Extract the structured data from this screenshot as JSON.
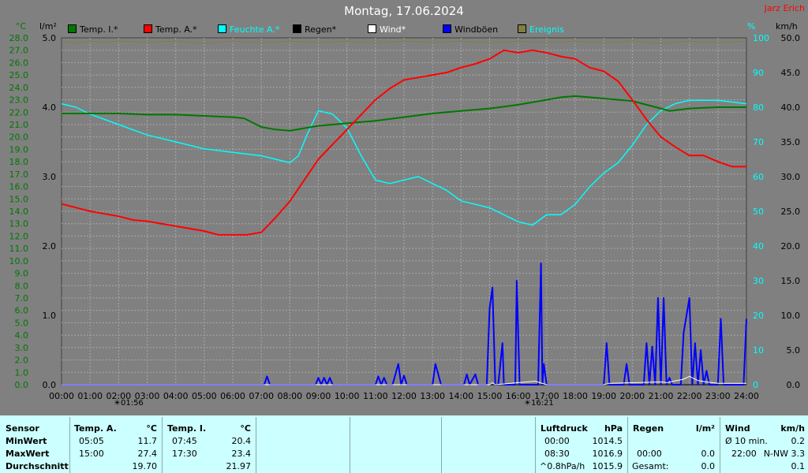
{
  "header": {
    "title": "Montag, 17.06.2024",
    "author": "Jarz Erich",
    "unit_temp": "°C",
    "unit_rain": "l/m²",
    "unit_hum": "%",
    "unit_wind": "km/h"
  },
  "legend": [
    {
      "label": "Temp. I.*",
      "color": "#007700"
    },
    {
      "label": "Temp. A.*",
      "color": "#ff0000"
    },
    {
      "label": "Feuchte A.*",
      "color": "#00ffff"
    },
    {
      "label": "Regen*",
      "color": "#000000"
    },
    {
      "label": "Wind*",
      "color": "#ffffff"
    },
    {
      "label": "Windböen",
      "color": "#0000ff"
    },
    {
      "label": "Ereignis",
      "color": "#808040"
    }
  ],
  "sun": {
    "sunrise": "01:56",
    "sunset": "16:21"
  },
  "chart_data": {
    "type": "line",
    "x_unit": "hours",
    "xlim": [
      0,
      24
    ],
    "x_ticks": [
      "00:00",
      "01:00",
      "02:00",
      "03:00",
      "04:00",
      "05:00",
      "06:00",
      "07:00",
      "08:00",
      "09:00",
      "10:00",
      "11:00",
      "12:00",
      "13:00",
      "14:00",
      "15:00",
      "16:00",
      "17:00",
      "18:00",
      "19:00",
      "20:00",
      "21:00",
      "22:00",
      "23:00",
      "24:00"
    ],
    "axes": {
      "temp": {
        "label": "°C",
        "min": 0,
        "max": 28,
        "step": 1
      },
      "rain": {
        "label": "l/m²",
        "min": 0,
        "max": 5,
        "ticks": [
          "0.0",
          "1.0",
          "2.0",
          "3.0",
          "4.0",
          "5.0"
        ]
      },
      "humidity": {
        "label": "%",
        "min": 0,
        "max": 100,
        "step": 10
      },
      "wind": {
        "label": "km/h",
        "min": 0,
        "max": 50,
        "step": 5
      }
    },
    "series": [
      {
        "name": "Temp. I.*",
        "axis": "temp",
        "color": "#007700",
        "points": [
          [
            0,
            21.9
          ],
          [
            1,
            21.9
          ],
          [
            2,
            21.9
          ],
          [
            3,
            21.8
          ],
          [
            4,
            21.8
          ],
          [
            5,
            21.7
          ],
          [
            6,
            21.6
          ],
          [
            6.4,
            21.5
          ],
          [
            7,
            20.8
          ],
          [
            7.5,
            20.6
          ],
          [
            8,
            20.5
          ],
          [
            8.5,
            20.7
          ],
          [
            9,
            20.9
          ],
          [
            10,
            21.1
          ],
          [
            11,
            21.3
          ],
          [
            12,
            21.6
          ],
          [
            13,
            21.9
          ],
          [
            14,
            22.1
          ],
          [
            15,
            22.3
          ],
          [
            16,
            22.6
          ],
          [
            17,
            23.0
          ],
          [
            17.5,
            23.2
          ],
          [
            18,
            23.3
          ],
          [
            18.5,
            23.2
          ],
          [
            19,
            23.1
          ],
          [
            20,
            22.9
          ],
          [
            20.5,
            22.6
          ],
          [
            21,
            22.3
          ],
          [
            21.3,
            22.1
          ],
          [
            22,
            22.3
          ],
          [
            23,
            22.4
          ],
          [
            24,
            22.4
          ]
        ]
      },
      {
        "name": "Temp. A.*",
        "axis": "temp",
        "color": "#ff0000",
        "points": [
          [
            0,
            14.6
          ],
          [
            0.5,
            14.3
          ],
          [
            1,
            14.0
          ],
          [
            2,
            13.6
          ],
          [
            2.5,
            13.3
          ],
          [
            3,
            13.2
          ],
          [
            4,
            12.8
          ],
          [
            5,
            12.4
          ],
          [
            5.5,
            12.1
          ],
          [
            6,
            12.1
          ],
          [
            6.5,
            12.1
          ],
          [
            7,
            12.3
          ],
          [
            7.5,
            13.5
          ],
          [
            8,
            14.8
          ],
          [
            8.5,
            16.5
          ],
          [
            9,
            18.2
          ],
          [
            9.5,
            19.4
          ],
          [
            10,
            20.6
          ],
          [
            10.5,
            21.8
          ],
          [
            11,
            23.0
          ],
          [
            11.5,
            23.9
          ],
          [
            12,
            24.6
          ],
          [
            12.5,
            24.8
          ],
          [
            13,
            25.0
          ],
          [
            13.5,
            25.2
          ],
          [
            14,
            25.6
          ],
          [
            14.5,
            25.9
          ],
          [
            15,
            26.3
          ],
          [
            15.5,
            27.0
          ],
          [
            16,
            26.8
          ],
          [
            16.5,
            27.0
          ],
          [
            17,
            26.8
          ],
          [
            17.5,
            26.5
          ],
          [
            18,
            26.3
          ],
          [
            18.5,
            25.6
          ],
          [
            19,
            25.3
          ],
          [
            19.5,
            24.5
          ],
          [
            20,
            23.0
          ],
          [
            20.5,
            21.4
          ],
          [
            21,
            20.0
          ],
          [
            21.5,
            19.2
          ],
          [
            22,
            18.5
          ],
          [
            22.5,
            18.5
          ],
          [
            23,
            18.0
          ],
          [
            23.5,
            17.6
          ],
          [
            24,
            17.6
          ]
        ]
      },
      {
        "name": "Feuchte A.*",
        "axis": "humidity",
        "color": "#00ffff",
        "points": [
          [
            0,
            81
          ],
          [
            0.5,
            80
          ],
          [
            1,
            78
          ],
          [
            2,
            75
          ],
          [
            3,
            72
          ],
          [
            4,
            70
          ],
          [
            5,
            68
          ],
          [
            6,
            67
          ],
          [
            7,
            66
          ],
          [
            8,
            64
          ],
          [
            8.3,
            66
          ],
          [
            8.6,
            72
          ],
          [
            9,
            79
          ],
          [
            9.5,
            78
          ],
          [
            10,
            74
          ],
          [
            10.5,
            66
          ],
          [
            11,
            59
          ],
          [
            11.5,
            58
          ],
          [
            12,
            59
          ],
          [
            12.5,
            60
          ],
          [
            13,
            58
          ],
          [
            13.5,
            56
          ],
          [
            14,
            53
          ],
          [
            15,
            51
          ],
          [
            15.5,
            49
          ],
          [
            16,
            47
          ],
          [
            16.5,
            46
          ],
          [
            17,
            49
          ],
          [
            17.5,
            49
          ],
          [
            18,
            52
          ],
          [
            18.5,
            57
          ],
          [
            19,
            61
          ],
          [
            19.5,
            64
          ],
          [
            20,
            69
          ],
          [
            20.5,
            75
          ],
          [
            21,
            79
          ],
          [
            21.5,
            81
          ],
          [
            22,
            82
          ],
          [
            23,
            82
          ],
          [
            24,
            81
          ]
        ]
      },
      {
        "name": "Windböen",
        "axis": "wind",
        "color": "#0000ff",
        "points": [
          [
            0,
            0
          ],
          [
            7.1,
            0
          ],
          [
            7.2,
            1.2
          ],
          [
            7.3,
            0
          ],
          [
            8.9,
            0
          ],
          [
            9.0,
            1.0
          ],
          [
            9.1,
            0
          ],
          [
            9.2,
            1.0
          ],
          [
            9.3,
            0
          ],
          [
            9.4,
            1.0
          ],
          [
            9.5,
            0
          ],
          [
            11.0,
            0
          ],
          [
            11.1,
            1.2
          ],
          [
            11.2,
            0
          ],
          [
            11.3,
            1.0
          ],
          [
            11.4,
            0
          ],
          [
            11.6,
            0
          ],
          [
            11.8,
            3.0
          ],
          [
            11.9,
            0
          ],
          [
            12.0,
            1.3
          ],
          [
            12.1,
            0
          ],
          [
            13.0,
            0
          ],
          [
            13.1,
            3.0
          ],
          [
            13.3,
            0
          ],
          [
            14.1,
            0
          ],
          [
            14.2,
            1.5
          ],
          [
            14.3,
            0
          ],
          [
            14.5,
            1.5
          ],
          [
            14.6,
            0
          ],
          [
            14.9,
            0
          ],
          [
            15.0,
            11.0
          ],
          [
            15.1,
            14.0
          ],
          [
            15.2,
            0
          ],
          [
            15.3,
            0
          ],
          [
            15.45,
            6.0
          ],
          [
            15.5,
            0
          ],
          [
            15.9,
            0
          ],
          [
            15.95,
            15.0
          ],
          [
            16.05,
            0
          ],
          [
            16.7,
            0
          ],
          [
            16.8,
            17.5
          ],
          [
            16.85,
            0
          ],
          [
            16.9,
            3.0
          ],
          [
            17.0,
            0
          ],
          [
            19.0,
            0
          ],
          [
            19.1,
            6.0
          ],
          [
            19.2,
            0
          ],
          [
            19.7,
            0
          ],
          [
            19.8,
            3.0
          ],
          [
            19.9,
            0
          ],
          [
            20.4,
            0
          ],
          [
            20.5,
            6.0
          ],
          [
            20.6,
            0
          ],
          [
            20.7,
            5.5
          ],
          [
            20.8,
            0
          ],
          [
            20.9,
            12.5
          ],
          [
            21.0,
            0
          ],
          [
            21.1,
            12.5
          ],
          [
            21.2,
            0
          ],
          [
            21.3,
            1.0
          ],
          [
            21.4,
            0
          ],
          [
            21.7,
            0
          ],
          [
            21.8,
            7.5
          ],
          [
            22.0,
            12.5
          ],
          [
            22.1,
            0
          ],
          [
            22.2,
            6.0
          ],
          [
            22.3,
            0
          ],
          [
            22.4,
            5.0
          ],
          [
            22.5,
            0
          ],
          [
            22.6,
            2.0
          ],
          [
            22.7,
            0
          ],
          [
            23.0,
            0
          ],
          [
            23.1,
            9.5
          ],
          [
            23.2,
            0
          ],
          [
            23.9,
            0
          ],
          [
            24.0,
            9.5
          ]
        ]
      },
      {
        "name": "Wind*",
        "axis": "wind",
        "color": "#ffffff",
        "points": [
          [
            0,
            0
          ],
          [
            15,
            0
          ],
          [
            15.1,
            0.3
          ],
          [
            15.2,
            0
          ],
          [
            16,
            0.3
          ],
          [
            16.6,
            0.5
          ],
          [
            17,
            0
          ],
          [
            19,
            0
          ],
          [
            19.2,
            0.2
          ],
          [
            21,
            0.4
          ],
          [
            21.2,
            0.3
          ],
          [
            21.8,
            0.8
          ],
          [
            22,
            1.2
          ],
          [
            22.3,
            0.6
          ],
          [
            22.6,
            0.4
          ],
          [
            23,
            0.2
          ],
          [
            24,
            0.2
          ]
        ]
      },
      {
        "name": "Ereignis",
        "axis": "humidity",
        "color": "#808040",
        "points": [
          [
            0,
            99
          ],
          [
            0.5,
            98.5
          ],
          [
            1,
            99
          ],
          [
            1.5,
            98.7
          ],
          [
            2,
            99
          ],
          [
            3,
            98.8
          ],
          [
            4,
            99
          ],
          [
            5,
            98.5
          ],
          [
            6,
            99
          ],
          [
            7,
            98.6
          ],
          [
            8,
            99
          ],
          [
            9,
            98.7
          ],
          [
            10,
            99
          ],
          [
            11,
            98.6
          ],
          [
            12,
            99
          ],
          [
            13,
            98.8
          ],
          [
            14,
            99
          ],
          [
            15,
            98.6
          ],
          [
            16,
            99
          ],
          [
            17,
            98.7
          ],
          [
            18,
            99
          ],
          [
            19,
            98.6
          ],
          [
            20,
            99
          ],
          [
            21,
            98.5
          ],
          [
            22,
            99
          ],
          [
            23,
            98.7
          ],
          [
            24,
            99
          ]
        ]
      },
      {
        "name": "Regen*",
        "axis": "rain",
        "color": "#000000",
        "points": [
          [
            0,
            0
          ],
          [
            24,
            0
          ]
        ]
      }
    ]
  },
  "stats": {
    "sensor": {
      "header": "Sensor",
      "rows": [
        "MinWert",
        "MaxWert",
        "Durchschnitt"
      ]
    },
    "temp_a": {
      "header": "Temp. A.",
      "unit": "°C",
      "rows": [
        {
          "time": "05:05",
          "value": "11.7"
        },
        {
          "time": "15:00",
          "value": "27.4"
        },
        {
          "time": "",
          "value": "19.70"
        }
      ]
    },
    "temp_i": {
      "header": "Temp. I.",
      "unit": "°C",
      "rows": [
        {
          "time": "07:45",
          "value": "20.4"
        },
        {
          "time": "17:30",
          "value": "23.4"
        },
        {
          "time": "",
          "value": "21.97"
        }
      ]
    },
    "pressure": {
      "header": "Luftdruck",
      "unit": "hPa",
      "rows": [
        {
          "time": "00:00",
          "value": "1014.5"
        },
        {
          "time": "08:30",
          "value": "1016.9"
        },
        {
          "time": "^0.8hPa/h",
          "value": "1015.9"
        }
      ]
    },
    "rain": {
      "header": "Regen",
      "unit": "l/m²",
      "rows": [
        {
          "time": "",
          "value": ""
        },
        {
          "time": "00:00",
          "value": "0.0"
        },
        {
          "time": "Gesamt:",
          "value": "0.0"
        }
      ],
      "first_value": "0.0"
    },
    "wind": {
      "header": "Wind",
      "unit": "km/h",
      "rows": [
        {
          "time": "Ø 10 min.",
          "value": "0.2"
        },
        {
          "time": "22:00",
          "value": "N-NW 3.3"
        },
        {
          "time": "",
          "value": "0.1"
        }
      ]
    }
  }
}
